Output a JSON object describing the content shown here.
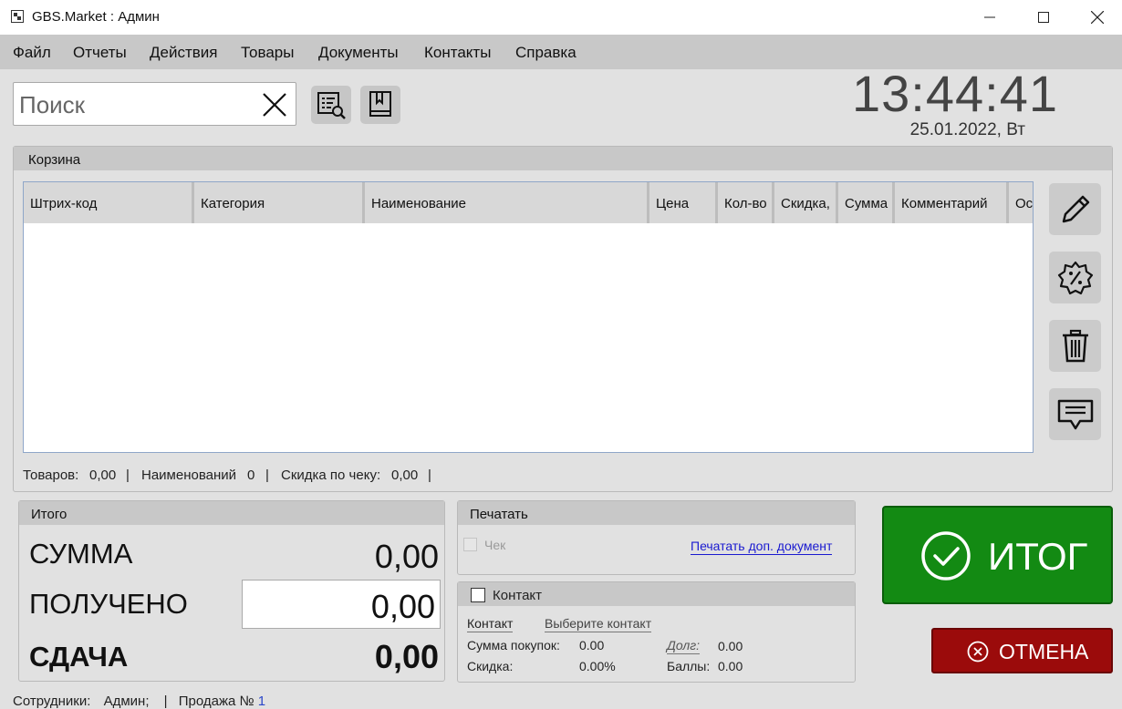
{
  "window": {
    "title": "GBS.Market : Админ"
  },
  "menu": [
    "Файл",
    "Отчеты",
    "Действия",
    "Товары",
    "Документы",
    "Контакты",
    "Справка"
  ],
  "search": {
    "placeholder": "Поиск",
    "value": ""
  },
  "clock": {
    "time": "13:44:41",
    "date": "25.01.2022, Вт"
  },
  "cart": {
    "title": "Корзина",
    "columns": [
      "Штрих-код",
      "Категория",
      "Наименование",
      "Цена",
      "Кол-во",
      "Скидка,",
      "Сумма",
      "Комментарий",
      "Ос"
    ],
    "summary": {
      "items_label": "Товаров:",
      "items_value": "0,00",
      "names_label": "Наименований",
      "names_value": "0",
      "discount_label": "Скидка по чеку:",
      "discount_value": "0,00",
      "sep": "|"
    }
  },
  "totals": {
    "title": "Итого",
    "sum_label": "СУММА",
    "sum_value": "0,00",
    "received_label": "ПОЛУЧЕНО",
    "received_value": "0,00",
    "change_label": "СДАЧА",
    "change_value": "0,00"
  },
  "print": {
    "title": "Печатать",
    "check_label": "Чек",
    "extra_doc_link": "Печатать доп. документ"
  },
  "contact": {
    "title": "Контакт",
    "contact_label": "Контакт",
    "contact_value": "Выберите контакт",
    "purchases_label": "Сумма покупок:",
    "purchases_value": "0.00",
    "discount_label": "Скидка:",
    "discount_value": "0.00%",
    "debt_label": "Долг:",
    "debt_value": "0.00",
    "points_label": "Баллы:",
    "points_value": "0.00"
  },
  "actions": {
    "itog_label": "ИТОГ",
    "cancel_label": "ОТМЕНА"
  },
  "status": {
    "staff_label": "Сотрудники:",
    "staff_value": "Админ;",
    "sep": "|",
    "sale_label": "Продажа №",
    "sale_value": "1"
  },
  "colors": {
    "itog_green": "#138a13",
    "cancel_red": "#9b0b0b",
    "link_blue": "#1a1ad0",
    "sale_number_blue": "#2b47c9"
  },
  "icons": [
    "app-icon",
    "minimize-icon",
    "maximize-icon",
    "close-icon",
    "clear-search-icon",
    "product-search-icon",
    "catalog-book-icon",
    "pencil-icon",
    "discount-badge-icon",
    "trash-icon",
    "comment-icon",
    "checkmark-circle-icon",
    "cancel-circle-icon"
  ]
}
